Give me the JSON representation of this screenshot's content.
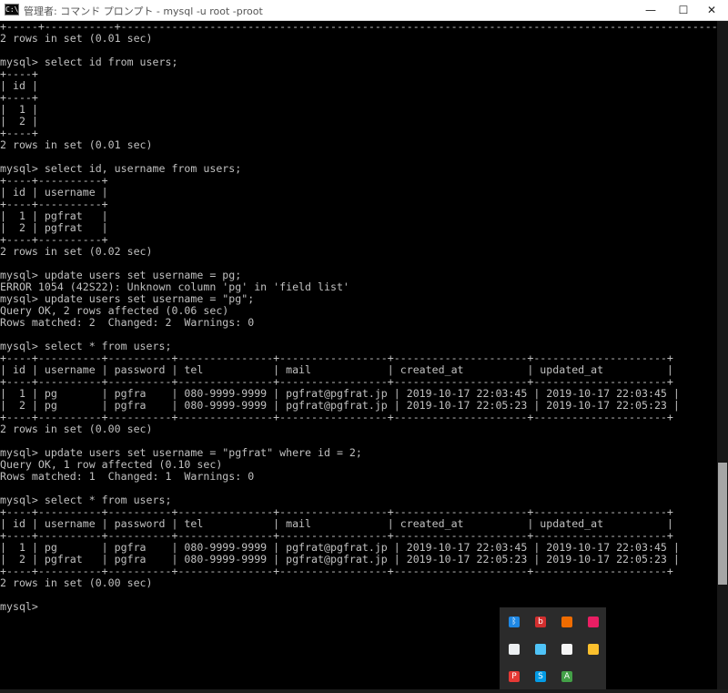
{
  "window": {
    "title": "管理者: コマンド プロンプト - mysql  -u root -proot",
    "icon_text": "C:\\",
    "minimize_glyph": "—",
    "maximize_glyph": "☐",
    "close_glyph": "✕"
  },
  "console": {
    "lines": [
      "+-----+-----------+------------------------------------------------------------------------------------------------------------------+",
      "2 rows in set (0.01 sec)",
      "",
      "mysql> select id from users;",
      "+----+",
      "| id |",
      "+----+",
      "|  1 |",
      "|  2 |",
      "+----+",
      "2 rows in set (0.01 sec)",
      "",
      "mysql> select id, username from users;",
      "+----+----------+",
      "| id | username |",
      "+----+----------+",
      "|  1 | pgfrat   |",
      "|  2 | pgfrat   |",
      "+----+----------+",
      "2 rows in set (0.02 sec)",
      "",
      "mysql> update users set username = pg;",
      "ERROR 1054 (42S22): Unknown column 'pg' in 'field list'",
      "mysql> update users set username = \"pg\";",
      "Query OK, 2 rows affected (0.06 sec)",
      "Rows matched: 2  Changed: 2  Warnings: 0",
      "",
      "mysql> select * from users;",
      "+----+----------+----------+---------------+-----------------+---------------------+---------------------+",
      "| id | username | password | tel           | mail            | created_at          | updated_at          |",
      "+----+----------+----------+---------------+-----------------+---------------------+---------------------+",
      "|  1 | pg       | pgfra    | 080-9999-9999 | pgfrat@pgfrat.jp | 2019-10-17 22:03:45 | 2019-10-17 22:03:45 |",
      "|  2 | pg       | pgfra    | 080-9999-9999 | pgfrat@pgfrat.jp | 2019-10-17 22:05:23 | 2019-10-17 22:05:23 |",
      "+----+----------+----------+---------------+-----------------+---------------------+---------------------+",
      "2 rows in set (0.00 sec)",
      "",
      "mysql> update users set username = \"pgfrat\" where id = 2;",
      "Query OK, 1 row affected (0.10 sec)",
      "Rows matched: 1  Changed: 1  Warnings: 0",
      "",
      "mysql> select * from users;",
      "+----+----------+----------+---------------+-----------------+---------------------+---------------------+",
      "| id | username | password | tel           | mail            | created_at          | updated_at          |",
      "+----+----------+----------+---------------+-----------------+---------------------+---------------------+",
      "|  1 | pg       | pgfra    | 080-9999-9999 | pgfrat@pgfrat.jp | 2019-10-17 22:03:45 | 2019-10-17 22:03:45 |",
      "|  2 | pgfrat   | pgfra    | 080-9999-9999 | pgfrat@pgfrat.jp | 2019-10-17 22:05:23 | 2019-10-17 22:05:23 |",
      "+----+----------+----------+---------------+-----------------+---------------------+---------------------+",
      "2 rows in set (0.00 sec)",
      "",
      "mysql>"
    ]
  },
  "tray": {
    "icons": [
      {
        "name": "bluetooth-icon",
        "color": "#1e88e5",
        "glyph": "ᛒ"
      },
      {
        "name": "beats-icon",
        "color": "#d32f2f",
        "glyph": "b"
      },
      {
        "name": "tray-app-orange-icon",
        "color": "#ef6c00",
        "glyph": ""
      },
      {
        "name": "tray-app-colorful-icon",
        "color": "#e91e63",
        "glyph": ""
      },
      {
        "name": "tray-app-document-icon",
        "color": "#eceff1",
        "glyph": ""
      },
      {
        "name": "tray-app-display-icon",
        "color": "#4fc3f7",
        "glyph": ""
      },
      {
        "name": "security-shield-icon",
        "color": "#f5f5f5",
        "glyph": ""
      },
      {
        "name": "chrome-icon",
        "color": "#fbc02d",
        "glyph": ""
      },
      {
        "name": "tray-app-red-icon",
        "color": "#e53935",
        "glyph": "P"
      },
      {
        "name": "skype-icon",
        "color": "#039be5",
        "glyph": "S"
      },
      {
        "name": "tray-app-green-icon",
        "color": "#43a047",
        "glyph": "A"
      }
    ]
  }
}
